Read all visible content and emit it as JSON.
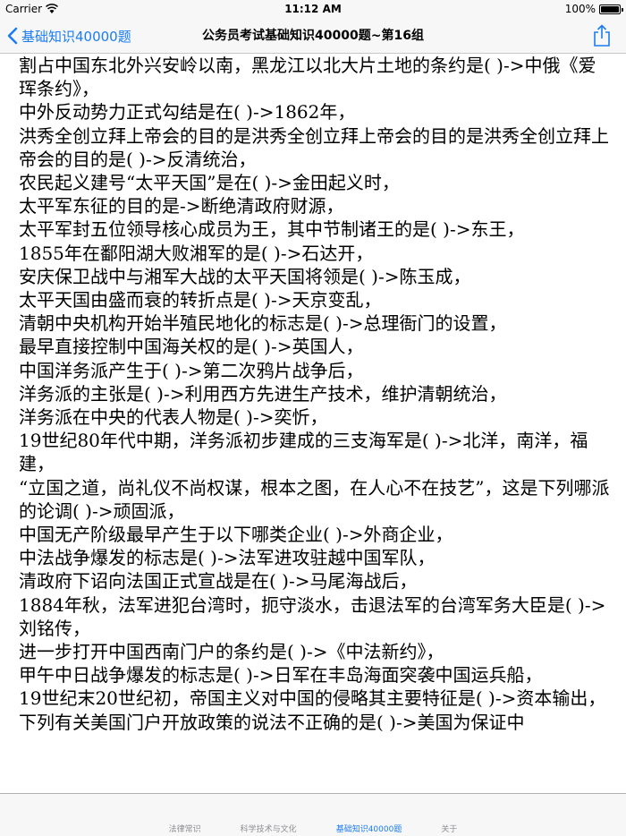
{
  "status_bar": {
    "carrier": "Carrier",
    "time": "11:12 AM",
    "battery": "100%"
  },
  "nav": {
    "back_label": "基础知识40000题",
    "title": "公务员考试基础知识40000题~第16组"
  },
  "content": {
    "text": "割占中国东北外兴安岭以南，黑龙江以北大片土地的条约是( )->中俄《爱珲条约》，\n中外反动势力正式勾结是在( )->1862年，\n洪秀全创立拜上帝会的目的是洪秀全创立拜上帝会的目的是洪秀全创立拜上帝会的目的是( )->反清统治，\n农民起义建号“太平天国”是在( )->金田起义时，\n太平军东征的目的是->断绝清政府财源，\n太平军封五位领导核心成员为王，其中节制诸王的是( )->东王，\n1855年在鄱阳湖大败湘军的是( )->石达开，\n安庆保卫战中与湘军大战的太平天国将领是( )->陈玉成，\n太平天国由盛而衰的转折点是( )->天京变乱，\n清朝中央机构开始半殖民地化的标志是( )->总理衙门的设置，\n最早直接控制中国海关权的是( )->英国人，\n中国洋务派产生于( )->第二次鸦片战争后，\n洋务派的主张是( )->利用西方先进生产技术，维护清朝统治，\n洋务派在中央的代表人物是( )->奕忻，\n19世纪80年代中期，洋务派初步建成的三支海军是( )->北洋，南洋，福建，\n“立国之道，尚礼仪不尚权谋，根本之图，在人心不在技艺”，这是下列哪派的论调( )->顽固派，\n中国无产阶级最早产生于以下哪类企业( )->外商企业，\n中法战争爆发的标志是( )->法军进攻驻越中国军队，\n清政府下诏向法国正式宣战是在( )->马尾海战后，\n1884年秋，法军进犯台湾时，扼守淡水，击退法军的台湾军务大臣是( )->刘铭传，\n进一步打开中国西南门户的条约是( )->《中法新约》，\n甲午中日战争爆发的标志是( )->日军在丰岛海面突袭中国运兵船，\n19世纪末20世纪初，帝国主义对中国的侵略其主要特征是( )->资本输出，\n下列有关美国门户开放政策的说法不正确的是( )->美国为保证中"
  },
  "tabs": [
    {
      "label": "法律常识"
    },
    {
      "label": "科学技术与文化"
    },
    {
      "label": "基础知识40000题"
    },
    {
      "label": "关于"
    }
  ],
  "colors": {
    "accent": "#1a7cf5",
    "bar_background": "#f7f7f7"
  }
}
